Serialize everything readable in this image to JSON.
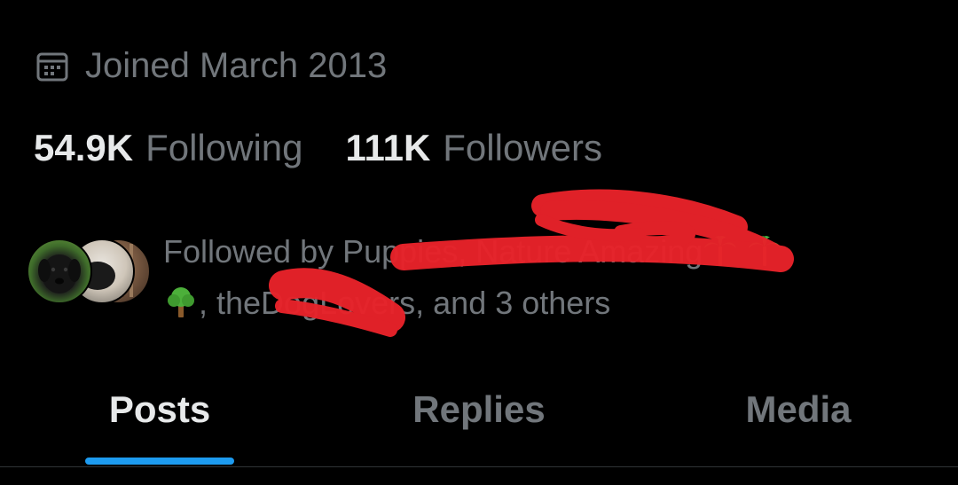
{
  "profile": {
    "joined_text": "Joined March 2013",
    "joined_icon": "calendar-icon",
    "following_count": "54.9K",
    "following_label": "Following",
    "followers_count": "111K",
    "followers_label": "Followers"
  },
  "followed_by": {
    "prefix": "Followed by Puppies, Nature Amazing",
    "second_line": ", theDogLovers, and 3 others",
    "emoji_palm": "🌴",
    "emoji_tree": "🌳",
    "avatars": [
      "dog-avatar",
      "photo-avatar",
      "tree-avatar"
    ]
  },
  "tabs": [
    {
      "label": "Posts",
      "active": true
    },
    {
      "label": "Replies",
      "active": false
    },
    {
      "label": "Media",
      "active": false
    }
  ],
  "colors": {
    "background": "#000000",
    "primary_text": "#e7e9ea",
    "secondary_text": "#71767b",
    "accent": "#1d9bf0",
    "redaction": "#e8232a"
  }
}
